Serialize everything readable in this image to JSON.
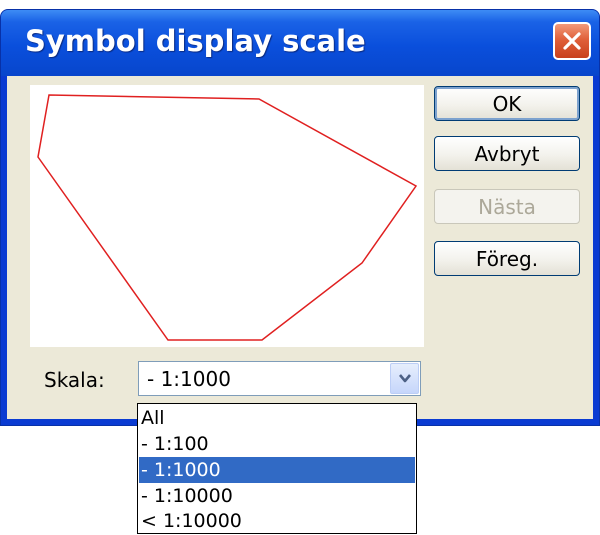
{
  "window": {
    "title": "Symbol display scale",
    "close_icon": "close-x-icon"
  },
  "colors": {
    "title_bar": "#0a4fdc",
    "close_button": "#e0603a",
    "dialog_face": "#ece9d8",
    "polygon_stroke": "#e02020",
    "selection": "#316ac5"
  },
  "buttons": {
    "ok": "OK",
    "cancel": "Avbryt",
    "next": "Nästa",
    "preview": "Föreg."
  },
  "scale": {
    "label": "Skala:",
    "selected": "- 1:1000",
    "arrow_icon": "chevron-down-icon",
    "options": [
      "All",
      "- 1:100",
      "- 1:1000",
      "- 1:10000",
      "< 1:10000"
    ],
    "highlighted_index": 2
  },
  "preview_shape": "red polygon outline"
}
